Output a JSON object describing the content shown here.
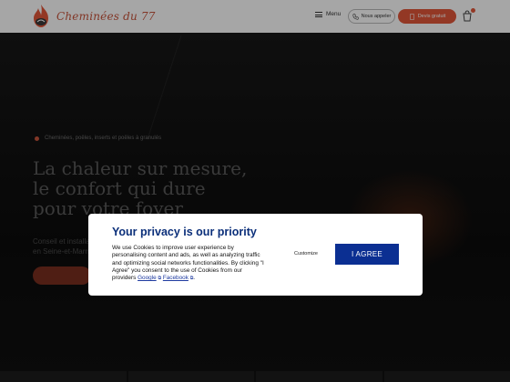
{
  "header": {
    "logo_text": "Cheminées du 77",
    "menu_label": "Menu",
    "outline_button_label": "Nous appeler",
    "fill_button_label": "Devis gratuit",
    "brand_color": "#e2573a"
  },
  "hero": {
    "breadcrumb": "Cheminées, poêles, inserts et poêles à granulés",
    "title": "La chaleur sur mesure,\nle confort qui dure\npour votre foyer",
    "subtitle": "Conseil et installation en Seine-et-Marne"
  },
  "cookie_modal": {
    "title": "Your privacy is our priority",
    "body_text": "We use Cookies to improve user experience by personalising content and ads, as well as analyzing traffic and optimizing social networks functionalities. By clicking \"I Agree\" you consent to the use of Cookies from our providers",
    "link_google": "Google",
    "link_facebook": "Facebook",
    "customize_label": "Customize",
    "agree_label": "I AGREE",
    "accent_color": "#0b2f92"
  }
}
